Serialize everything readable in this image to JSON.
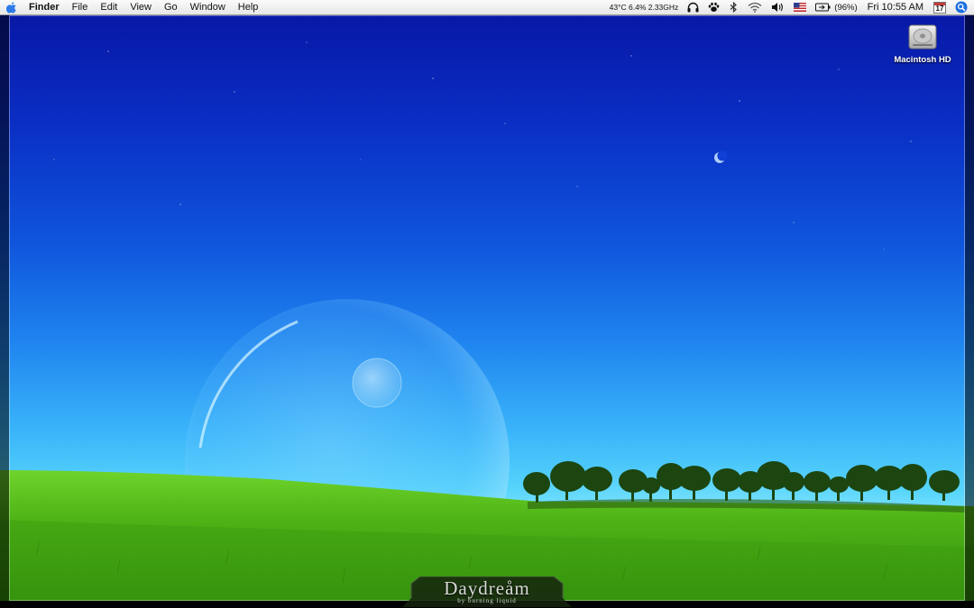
{
  "menubar": {
    "app_name": "Finder",
    "menus": [
      "File",
      "Edit",
      "View",
      "Go",
      "Window",
      "Help"
    ],
    "status": {
      "system_stats": "43°C 6.4% 2.33GHz",
      "battery": "(96%)",
      "clock": "Fri 10:55 AM",
      "calendar_day": "17"
    },
    "icons": [
      "apple-icon",
      "headphones-icon",
      "growl-paw-icon",
      "bluetooth-icon",
      "wifi-icon",
      "volume-icon",
      "us-flag-icon",
      "battery-icon",
      "calendar-icon",
      "spotlight-icon"
    ]
  },
  "desktop": {
    "icons": [
      {
        "label": "Macintosh HD",
        "icon": "hard-drive-icon"
      }
    ],
    "wallpaper_logo": {
      "title": "Daydreåm",
      "subtitle": "by burning liquid"
    }
  },
  "colors": {
    "sky_top": "#0818a6",
    "sky_horizon": "#7fe6ff",
    "grass": "#3f9e12",
    "spotlight": "#1d6fe0"
  }
}
